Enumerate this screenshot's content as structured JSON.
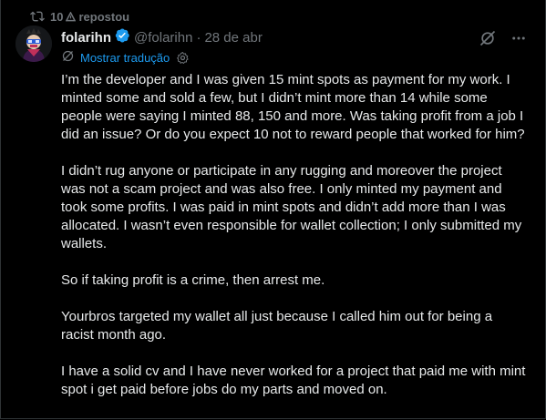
{
  "repost": {
    "count": "10",
    "label": "repostou"
  },
  "tweet": {
    "author_name": "folarihn",
    "handle": "@folarihn",
    "separator": "·",
    "date": "28 de abr",
    "translate_label": "Mostrar tradução",
    "paragraphs": [
      "I’m the developer and I was given 15 mint spots as payment for my work. I minted some and sold a few, but I didn’t mint more than 14 while some people were saying I minted 88, 150 and more. Was taking profit from a job I did an issue? Or do you expect 10 not to reward people that worked for him?",
      "I didn’t rug anyone or participate in any rugging and moreover the project was not a scam project and was also free. I only minted my payment and took some profits. I was paid in mint spots and didn’t add more than I was allocated. I wasn’t even responsible for wallet collection; I only submitted my wallets.",
      "So if taking profit is a crime, then arrest me.",
      "Yourbros targeted my wallet all just because I called him out for being a racist month ago.",
      "I have a solid cv and I have never worked for a project that paid me with mint spot i get paid before jobs do my parts and moved on."
    ]
  },
  "icons": {
    "repost": "repost-icon",
    "verified": "verified-badge-icon",
    "grok": "grok-icon",
    "more": "more-icon",
    "translate": "translate-icon",
    "settings": "gear-icon"
  },
  "colors": {
    "background": "#000000",
    "text": "#e7e9ea",
    "muted": "#71767b",
    "accent": "#1d9bf0"
  }
}
